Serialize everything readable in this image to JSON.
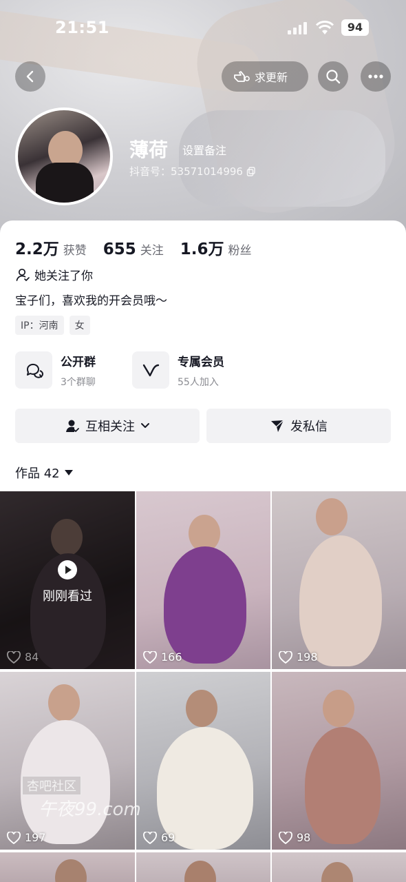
{
  "status_bar": {
    "time": "21:51",
    "battery": "94"
  },
  "header": {
    "update_label": "求更新",
    "name": "薄荷",
    "remark_label": "设置备注",
    "douyin_id": "抖音号：53571014996"
  },
  "stats": [
    {
      "value": "2.2万",
      "label": "获赞"
    },
    {
      "value": "655",
      "label": "关注"
    },
    {
      "value": "1.6万",
      "label": "粉丝"
    }
  ],
  "follows_you": "她关注了你",
  "bio": "宝子们，喜欢我的开会员哦～",
  "tags": [
    "IP：河南",
    "女"
  ],
  "features": [
    {
      "title": "公开群",
      "subtitle": "3个群聊",
      "icon": "chat-bubble-icon"
    },
    {
      "title": "专属会员",
      "subtitle": "55人加入",
      "icon": "v-member-icon"
    }
  ],
  "actions": {
    "follow_label": "互相关注",
    "message_label": "发私信"
  },
  "works": {
    "label": "作品 42"
  },
  "videos": [
    {
      "likes": "84",
      "watched_label": "刚刚看过"
    },
    {
      "likes": "166"
    },
    {
      "likes": "198"
    },
    {
      "likes": "197"
    },
    {
      "likes": "69"
    },
    {
      "likes": "98"
    }
  ],
  "watermark": {
    "line1": "杏吧社区",
    "line2": "午夜99.com"
  },
  "colors": {
    "accent_text": "#161823",
    "secondary_text": "#6a6b73",
    "chip_bg": "#f2f2f4"
  }
}
